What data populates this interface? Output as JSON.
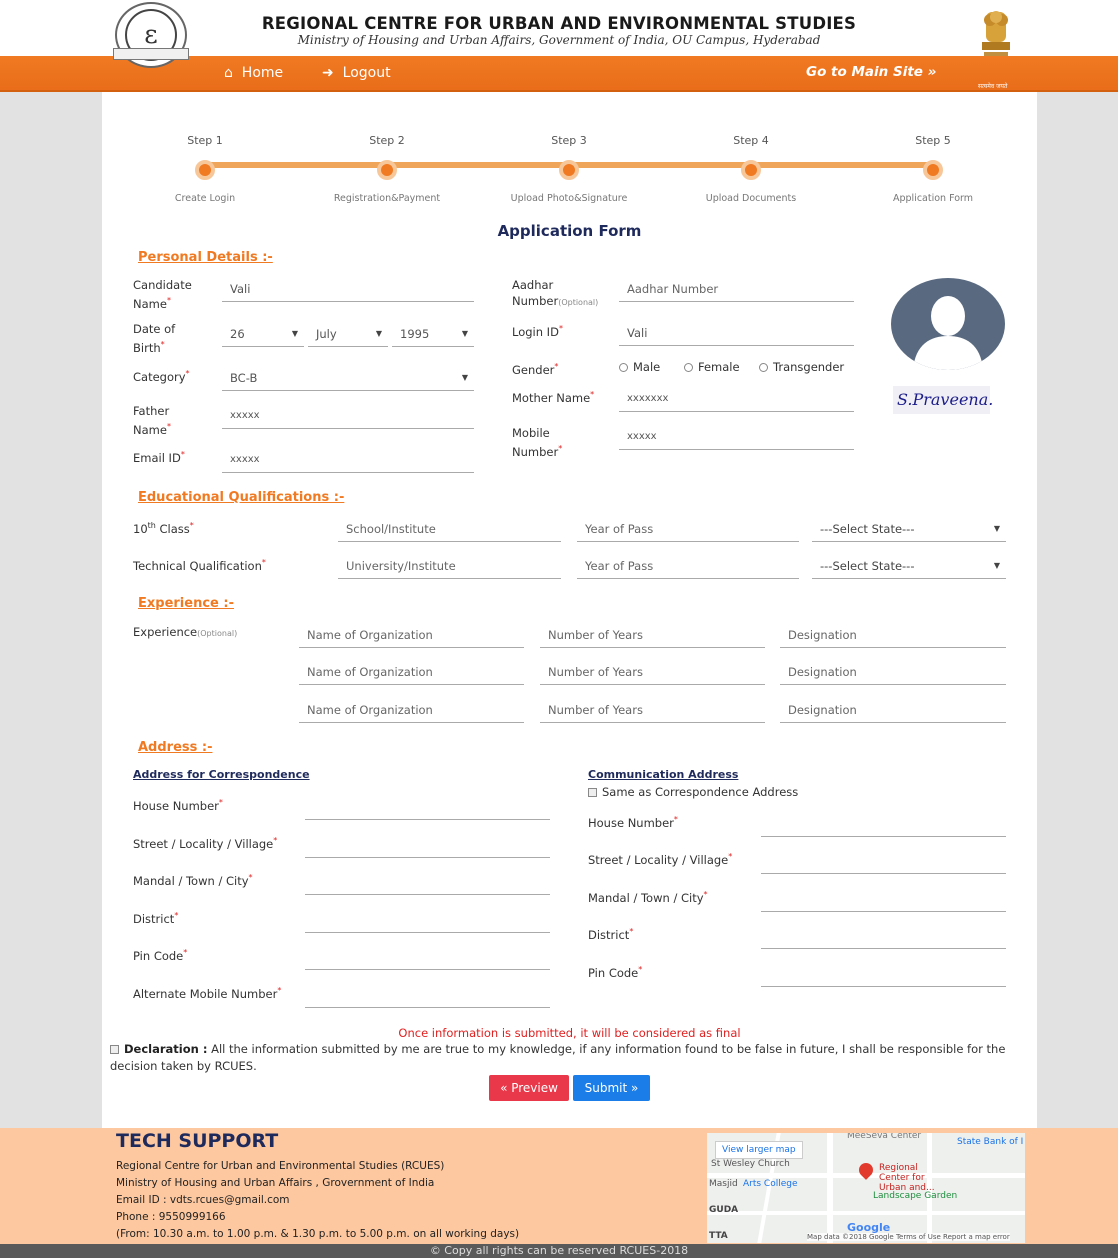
{
  "header": {
    "title": "REGIONAL CENTRE FOR URBAN AND ENVIRONMENTAL STUDIES",
    "subtitle": "Ministry of Housing and Urban Affairs, Government of India, OU Campus, Hyderabad"
  },
  "nav": {
    "home": "Home",
    "logout": "Logout",
    "main_site": "Go to Main Site »"
  },
  "steps": [
    {
      "label": "Step 1",
      "caption": "Create Login"
    },
    {
      "label": "Step 2",
      "caption": "Registration&Payment"
    },
    {
      "label": "Step 3",
      "caption": "Upload Photo&Signature"
    },
    {
      "label": "Step 4",
      "caption": "Upload Documents"
    },
    {
      "label": "Step 5",
      "caption": "Application Form"
    }
  ],
  "form_title": "Application Form",
  "personal": {
    "title": "Personal Details :-",
    "candidate_label1": "Candidate",
    "candidate_label2": "Name",
    "candidate_value": "Vali",
    "dob_label1": "Date of",
    "dob_label2": "Birth",
    "dob_day": "26",
    "dob_month": "July",
    "dob_year": "1995",
    "category_label": "Category",
    "category_value": "BC-B",
    "father_label1": "Father",
    "father_label2": "Name",
    "father_value": "xxxxx",
    "email_label": "Email ID",
    "email_value": "xxxxx",
    "aadhar_label1": "Aadhar",
    "aadhar_label2": "Number",
    "aadhar_optional": "(Optional)",
    "aadhar_placeholder": "Aadhar Number",
    "login_label": "Login ID",
    "login_value": "Vali",
    "gender_label": "Gender",
    "gender_options": [
      "Male",
      "Female",
      "Transgender"
    ],
    "mother_label": "Mother Name",
    "mother_value": "xxxxxxx",
    "mobile_label1": "Mobile",
    "mobile_label2": "Number",
    "mobile_value": "xxxxx",
    "signature_text": "S.Praveena."
  },
  "education": {
    "title": "Educational Qualifications :-",
    "tenth_label": "10",
    "tenth_sup": "th",
    "tenth_label_rest": " Class",
    "tech_label": "Technical Qualification",
    "school_placeholder": "School/Institute",
    "university_placeholder": "University/Institute",
    "year_placeholder": "Year of Pass",
    "state_placeholder": "---Select State---"
  },
  "experience": {
    "title": "Experience :-",
    "label": "Experience",
    "optional": "(Optional)",
    "org_placeholder": "Name of Organization",
    "years_placeholder": "Number of Years",
    "designation_placeholder": "Designation"
  },
  "address": {
    "title": "Address :-",
    "correspondence_title": "Address for Correspondence",
    "communication_title": "Communication Address",
    "same_as": "Same as Correspondence Address",
    "house": "House Number",
    "street": "Street / Locality / Village",
    "mandal": "Mandal / Town / City",
    "district": "District",
    "pin": "Pin Code",
    "alt_mobile": "Alternate Mobile Number"
  },
  "warning": "Once information is submitted, it will be considered as final",
  "declaration": {
    "bold": "Declaration :",
    "text": " All the information submitted by me are true to my knowledge, if any information found to be false in future, I shall be responsible for the decision taken by RCUES."
  },
  "buttons": {
    "preview": "« Preview",
    "submit": "Submit »"
  },
  "footer": {
    "title": "TECH SUPPORT",
    "line1": "Regional Centre for Urban and Environmental Studies (RCUES)",
    "line2": "Ministry of Housing and Urban Affairs , Grovernment of India",
    "line3": "Email ID : vdts.rcues@gmail.com",
    "line4": "Phone : 9550999166",
    "line5": "(From: 10.30 a.m. to 1.00 p.m. & 1.30 p.m. to 5.00 p.m. on all working days)",
    "copyright": "© Copy all rights can be reserved RCUES-2018"
  },
  "map": {
    "view_larger": "View larger map",
    "label_center": "Regional Center for Urban and...",
    "label_arts": "Arts College",
    "label_garden": "Landscape Garden",
    "label_bank": "State Bank of I",
    "label_meeseva": "MeeSeva Center",
    "label_church": "St Wesley Church",
    "label_masjid": "Masjid",
    "label_guda": "GUDA",
    "label_tta": "TTA",
    "google": "Google",
    "footer_text": "Map data ©2018 Google   Terms of Use   Report a map error"
  },
  "colors": {
    "accent": "#f07a22",
    "title_blue": "#1f2a5c",
    "footer_bg": "#fdc8a0",
    "preview_btn": "#e8384a",
    "submit_btn": "#1a7de8"
  }
}
